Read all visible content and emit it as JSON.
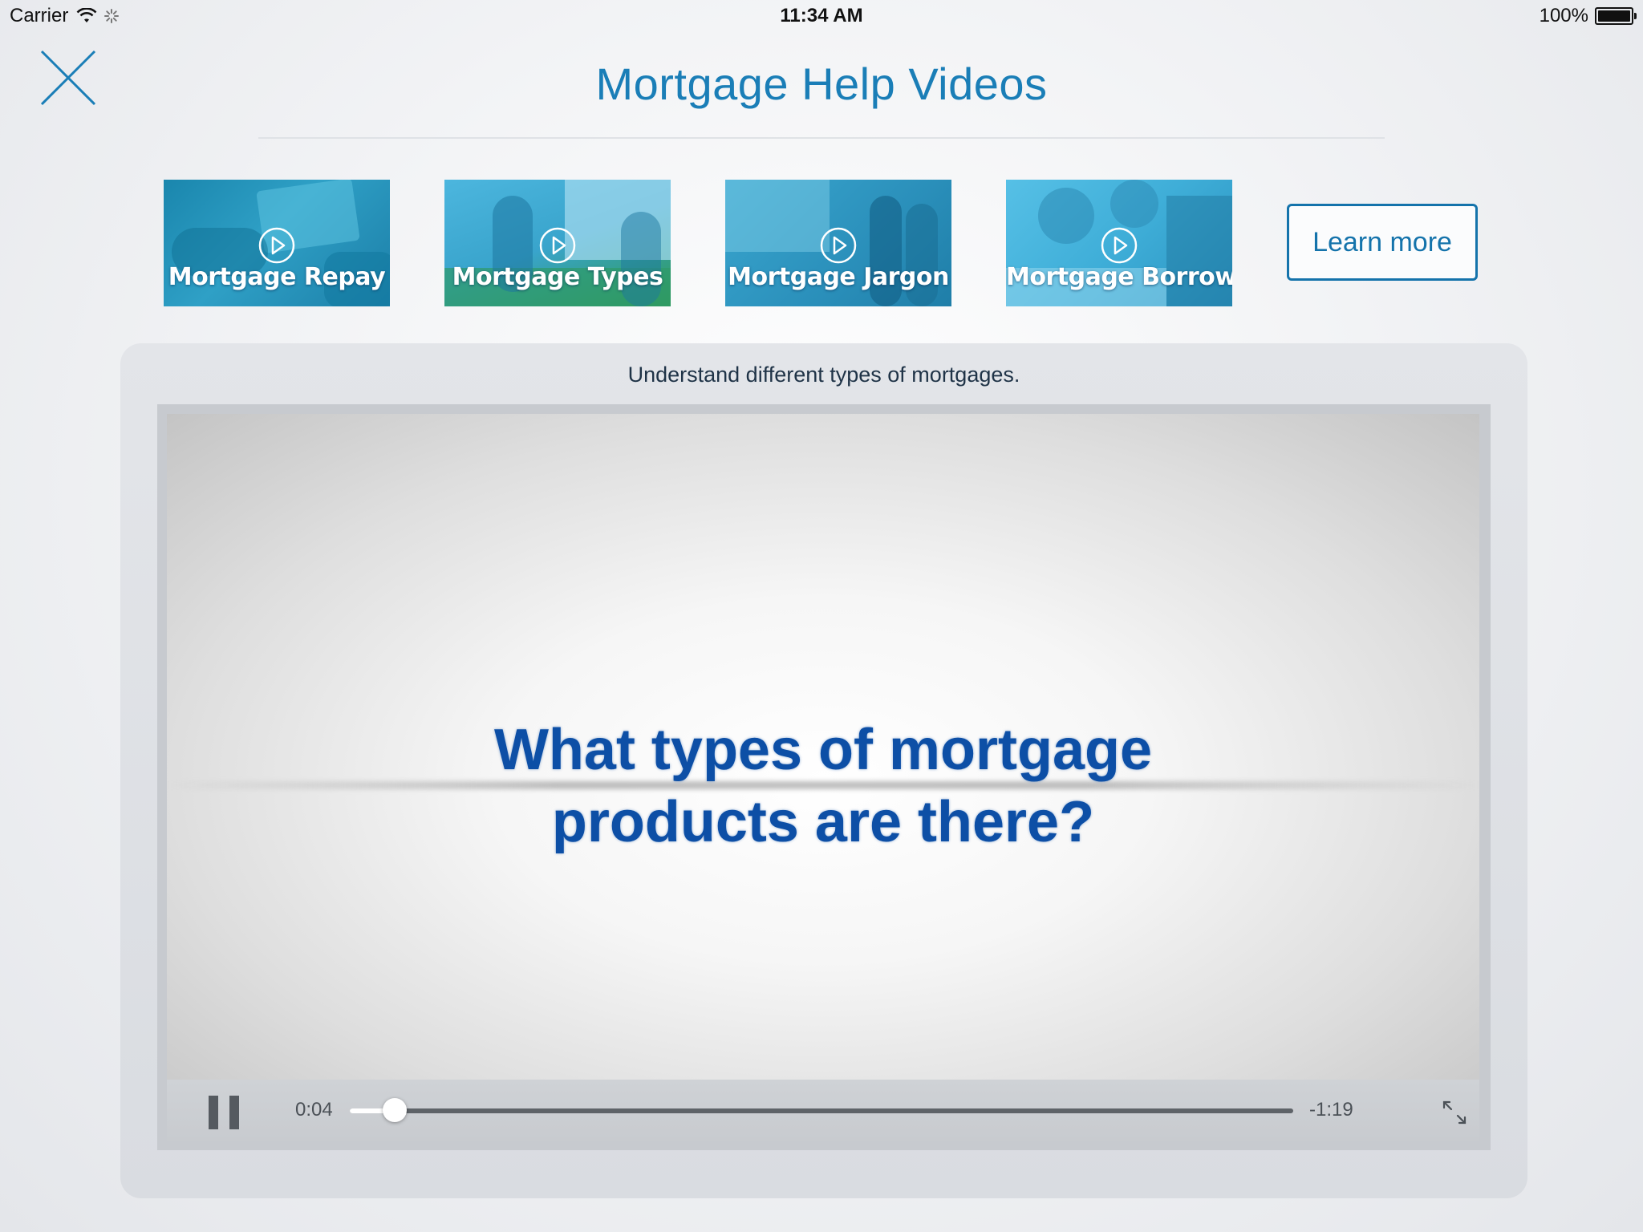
{
  "status_bar": {
    "carrier": "Carrier",
    "time": "11:34 AM",
    "battery": "100%",
    "battery_level": 1.0
  },
  "header": {
    "title": "Mortgage Help Videos",
    "close_icon": "close-x-icon"
  },
  "videos": [
    {
      "label": "Mortgage Repay",
      "icon": "play-circle-icon"
    },
    {
      "label": "Mortgage Types",
      "icon": "play-circle-icon"
    },
    {
      "label": "Mortgage Jargon",
      "icon": "play-circle-icon"
    },
    {
      "label": "Mortgage Borrow",
      "icon": "play-circle-icon"
    }
  ],
  "learn_more_label": "Learn more",
  "player": {
    "caption": "Understand different types of mortgages.",
    "video_text_line1": "What types of mortgage",
    "video_text_line2": "products are there?",
    "elapsed": "0:04",
    "remaining": "-1:19",
    "progress": 0.048,
    "pause_icon": "pause-icon",
    "fullscreen_icon": "fullscreen-expand-icon"
  },
  "colors": {
    "accent": "#1a7eb7",
    "button_border": "#1473ab",
    "video_text": "#0d4fa6"
  }
}
